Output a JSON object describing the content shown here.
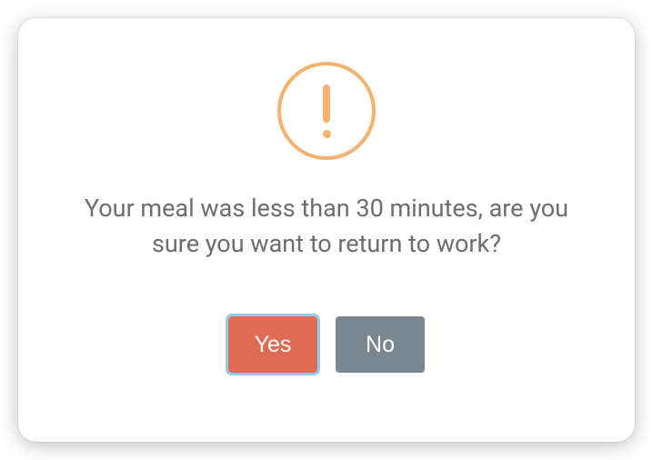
{
  "dialog": {
    "message": "Your meal was less than 30 minutes, are you sure you want to return to work?",
    "yes_label": "Yes",
    "no_label": "No"
  }
}
